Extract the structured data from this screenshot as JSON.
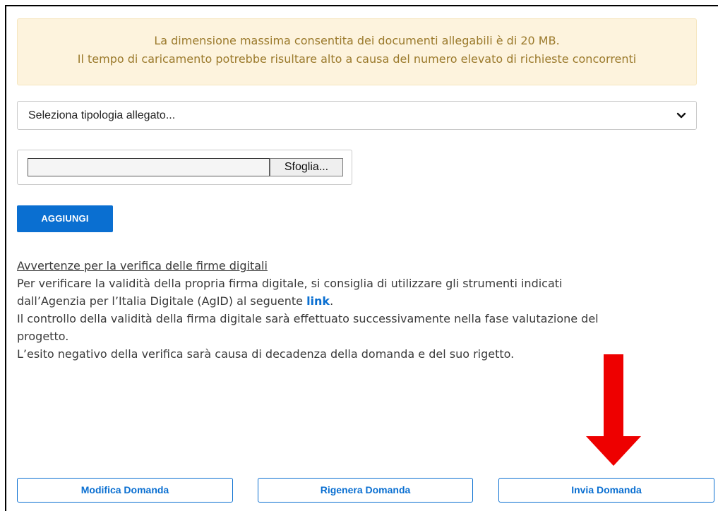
{
  "notice": {
    "line1": "La dimensione massima consentita dei documenti allegabili è di 20 MB.",
    "line2": "Il tempo di caricamento potrebbe risultare alto a causa del numero elevato di richieste concorrenti"
  },
  "attachment_type_select": {
    "selected": "Seleziona tipologia allegato..."
  },
  "file_picker": {
    "value": "",
    "browse_label": "Sfoglia..."
  },
  "add_button": {
    "label": "AGGIUNGI"
  },
  "signature_info": {
    "title": "Avvertenze per la verifica delle firme digitali",
    "line1": "Per verificare la validità della propria firma digitale, si consiglia di utilizzare gli strumenti indicati",
    "line2_before_link": "dall’Agenzia per l’Italia Digitale (AgID) al seguente ",
    "link_text": "link",
    "line2_after_link": ".",
    "line3": "Il controllo della validità della firma digitale sarà effettuato successivamente nella fase valutazione del",
    "line4": "progetto.",
    "line5": "L’esito negativo della verifica sarà causa di decadenza della domanda e del suo rigetto."
  },
  "actions": {
    "modify_label": "Modifica Domanda",
    "regenerate_label": "Rigenera Domanda",
    "submit_label": "Invia Domanda"
  },
  "icons": {
    "dropdown": "chevron-down-icon",
    "highlight": "red-arrow-down-icon"
  },
  "colors": {
    "accent": "#0a6fd1",
    "notice_bg": "#fdf3dd",
    "notice_text": "#9b7a2c",
    "highlight_arrow": "#ee0000"
  }
}
